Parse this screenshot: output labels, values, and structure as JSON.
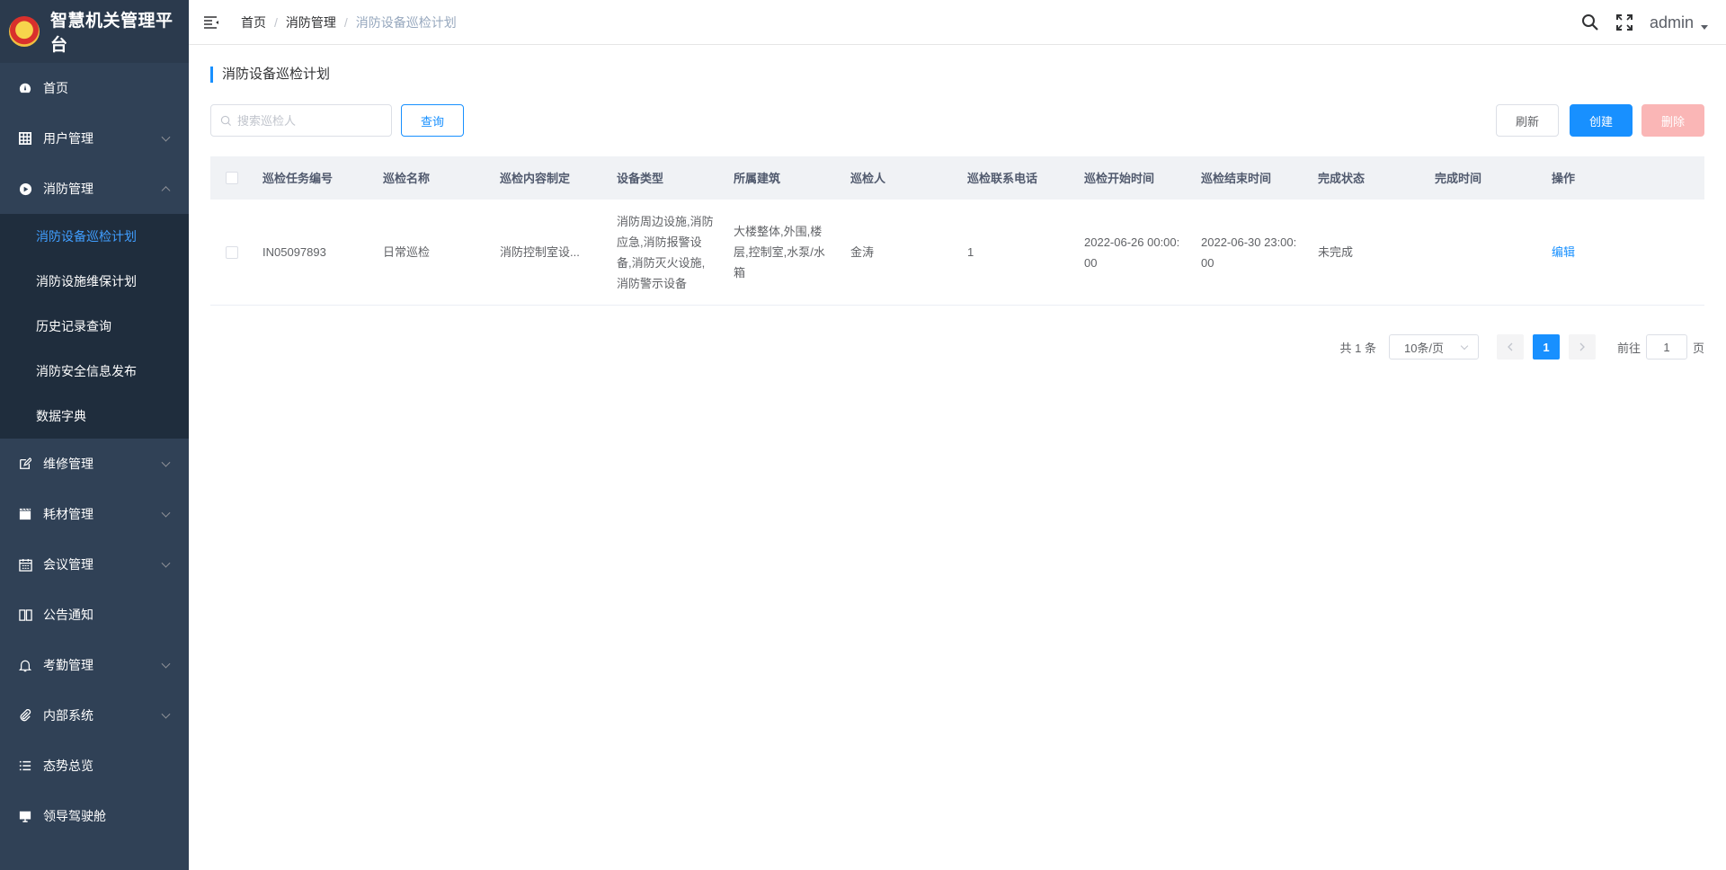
{
  "app": {
    "title": "智慧机关管理平台"
  },
  "sidebar": {
    "items": [
      {
        "label": "首页",
        "icon": "dashboard-icon",
        "expandable": false
      },
      {
        "label": "用户管理",
        "icon": "table-icon",
        "expandable": true
      },
      {
        "label": "消防管理",
        "icon": "fire-icon",
        "expandable": true,
        "expanded": true,
        "children": [
          {
            "label": "消防设备巡检计划",
            "active": true
          },
          {
            "label": "消防设施维保计划"
          },
          {
            "label": "历史记录查询"
          },
          {
            "label": "消防安全信息发布"
          },
          {
            "label": "数据字典"
          }
        ]
      },
      {
        "label": "维修管理",
        "icon": "edit-icon",
        "expandable": true
      },
      {
        "label": "耗材管理",
        "icon": "clapper-icon",
        "expandable": true
      },
      {
        "label": "会议管理",
        "icon": "calendar-icon",
        "expandable": true
      },
      {
        "label": "公告通知",
        "icon": "book-icon",
        "expandable": false
      },
      {
        "label": "考勤管理",
        "icon": "bell-icon",
        "expandable": true
      },
      {
        "label": "内部系统",
        "icon": "paperclip-icon",
        "expandable": true
      },
      {
        "label": "态势总览",
        "icon": "list-icon",
        "expandable": false
      },
      {
        "label": "领导驾驶舱",
        "icon": "monitor-icon",
        "expandable": false
      }
    ]
  },
  "header": {
    "breadcrumb": [
      "首页",
      "消防管理",
      "消防设备巡检计划"
    ],
    "user": "admin"
  },
  "page": {
    "title": "消防设备巡检计划",
    "search_placeholder": "搜索巡检人",
    "query_label": "查询",
    "refresh_label": "刷新",
    "create_label": "创建",
    "delete_label": "删除"
  },
  "table": {
    "columns": [
      "巡检任务编号",
      "巡检名称",
      "巡检内容制定",
      "设备类型",
      "所属建筑",
      "巡检人",
      "巡检联系电话",
      "巡检开始时间",
      "巡检结束时间",
      "完成状态",
      "完成时间",
      "操作"
    ],
    "rows": [
      {
        "id": "IN05097893",
        "name": "日常巡检",
        "content": "消防控制室设...",
        "device_type": "消防周边设施,消防应急,消防报警设备,消防灭火设施,消防警示设备",
        "building": "大楼整体,外围,楼层,控制室,水泵/水箱",
        "inspector": "金涛",
        "phone": "1",
        "start_time": "2022-06-26 00:00:00",
        "end_time": "2022-06-30 23:00:00",
        "status": "未完成",
        "finish_time": "",
        "action": "编辑"
      }
    ]
  },
  "pagination": {
    "total_text": "共 1 条",
    "page_size": "10条/页",
    "current_page": "1",
    "goto_label": "前往",
    "goto_value": "1",
    "page_unit": "页"
  },
  "colors": {
    "primary": "#1890ff",
    "sidebar_bg": "#304156",
    "submenu_bg": "#1f2d3d",
    "danger_disabled": "#fab6b6"
  }
}
